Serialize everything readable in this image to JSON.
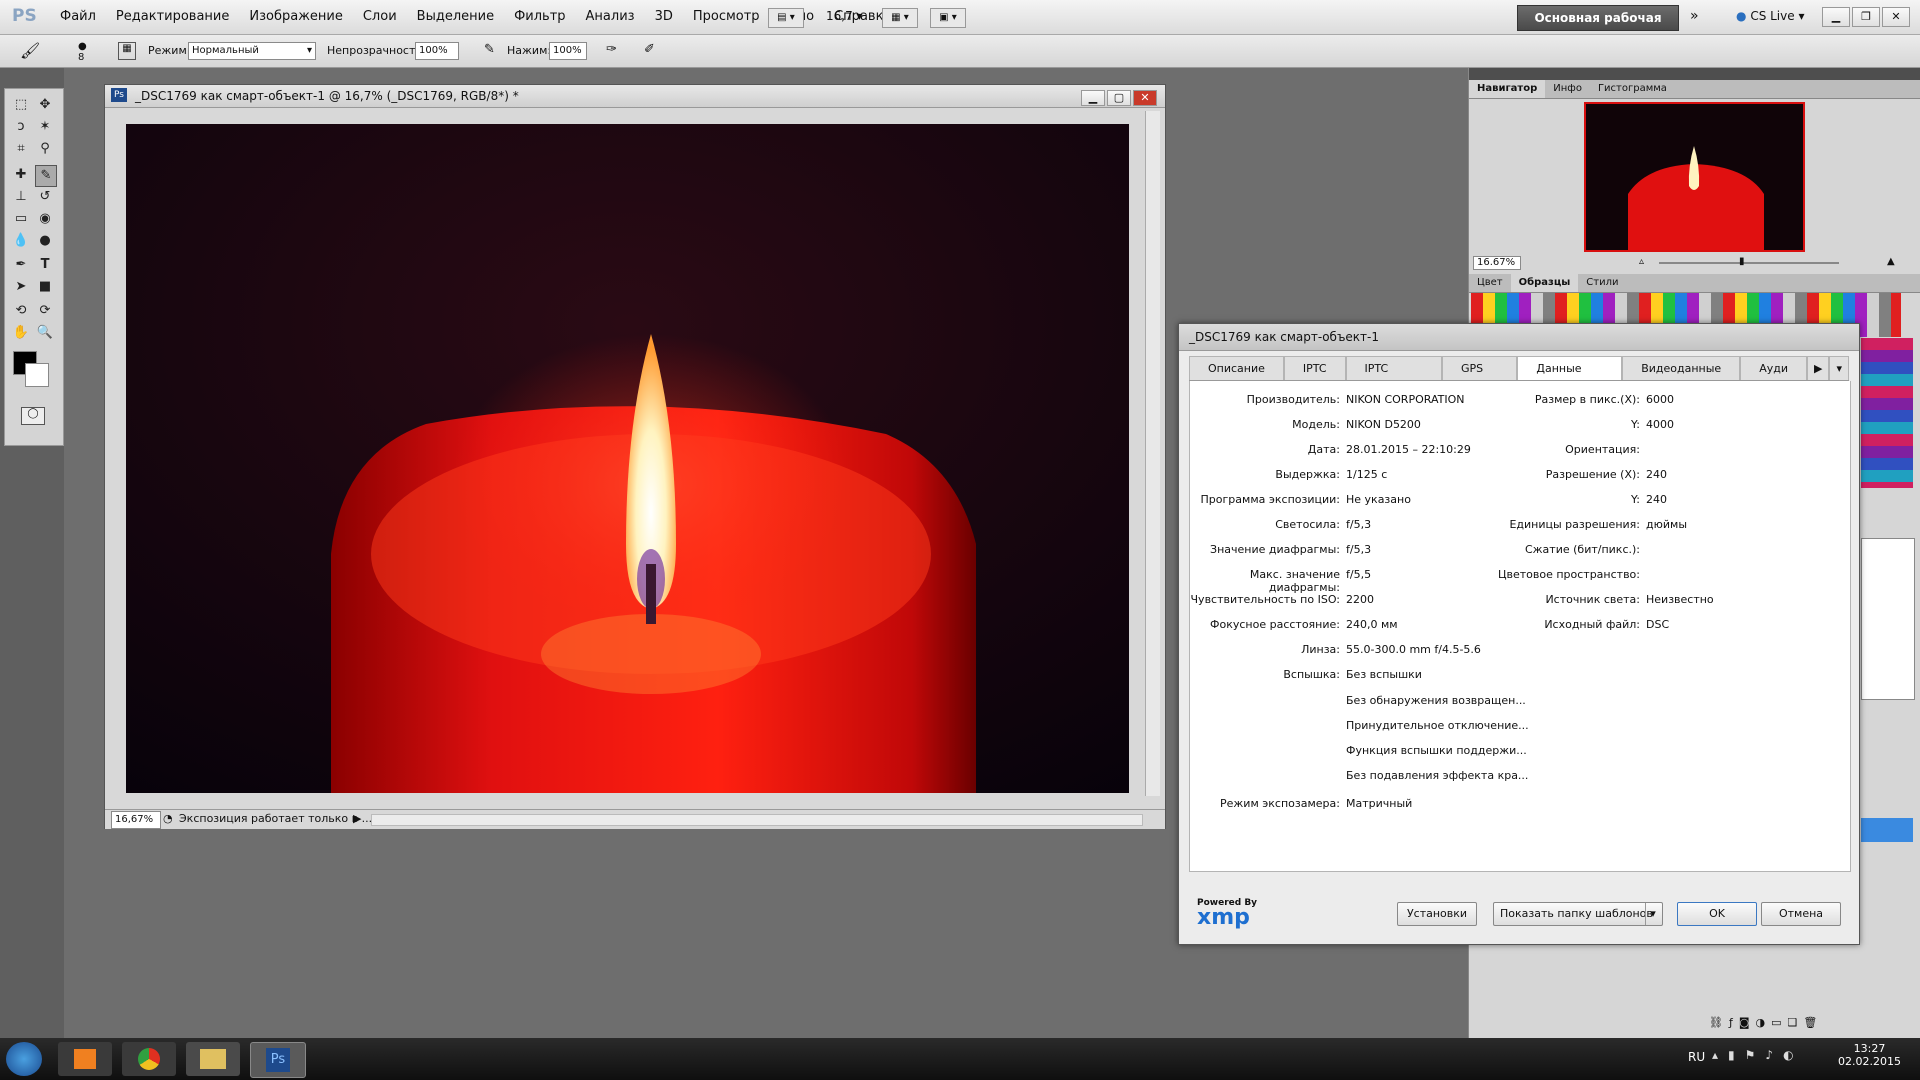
{
  "app": {
    "logo": "PS",
    "menu": [
      "Файл",
      "Редактирование",
      "Изображение",
      "Слои",
      "Выделение",
      "Фильтр",
      "Анализ",
      "3D",
      "Просмотр",
      "Окно",
      "Справка"
    ],
    "zoom_menu": "16,7",
    "workspace": "Основная рабочая среда",
    "cs_live": "CS Live"
  },
  "options": {
    "mode_label": "Режим:",
    "mode_value": "Нормальный",
    "opacity_label": "Непрозрачности:",
    "opacity_value": "100%",
    "pressure_label": "Нажим:",
    "pressure_value": "100%"
  },
  "document": {
    "title": "_DSC1769 как смарт-объект-1 @ 16,7% (_DSC1769, RGB/8*) *",
    "zoom": "16,67%",
    "status": "Экспозиция работает только в ..."
  },
  "panels": {
    "top_tabs": [
      "Навигатор",
      "Инфо",
      "Гистограмма"
    ],
    "nav_zoom": "16.67%",
    "color_tabs": [
      "Цвет",
      "Образцы",
      "Стили"
    ]
  },
  "dialog": {
    "title": "_DSC1769 как смарт-объект-1",
    "tabs": [
      "Описание",
      "IPTC",
      "IPTC Extension",
      "GPS Data",
      "Данные камеры",
      "Видеоданные",
      "Ауди"
    ],
    "active_tab": 4,
    "left_fields": [
      {
        "label": "Производитель:",
        "value": "NIKON CORPORATION"
      },
      {
        "label": "Модель:",
        "value": "NIKON D5200"
      },
      {
        "label": "Дата:",
        "value": "28.01.2015 – 22:10:29"
      },
      {
        "label": "Выдержка:",
        "value": "1/125 с"
      },
      {
        "label": "Программа экспозиции:",
        "value": "Не указано"
      },
      {
        "label": "Светосила:",
        "value": "f/5,3"
      },
      {
        "label": "Значение диафрагмы:",
        "value": "f/5,3"
      },
      {
        "label": "Макс. значение диафрагмы:",
        "value": "f/5,5"
      },
      {
        "label": "Чувствительность по ISO:",
        "value": "2200"
      },
      {
        "label": "Фокусное расстояние:",
        "value": "240,0 мм"
      },
      {
        "label": "Линза:",
        "value": "55.0-300.0 mm f/4.5-5.6"
      },
      {
        "label": "Вспышка:",
        "value": "Без вспышки"
      }
    ],
    "flash_extra": [
      "Без обнаружения возвращен...",
      "Принудительное отключение...",
      "Функция вспышки поддержи...",
      "Без подавления эффекта кра..."
    ],
    "metering": {
      "label": "Режим экспозамера:",
      "value": "Матричный"
    },
    "right_fields": [
      {
        "label": "Размер в пикс.(X):",
        "value": "6000"
      },
      {
        "label": "Y:",
        "value": "4000"
      },
      {
        "label": "Ориентация:",
        "value": ""
      },
      {
        "label": "Разрешение (X):",
        "value": "240"
      },
      {
        "label": "Y:",
        "value": "240"
      },
      {
        "label": "Единицы разрешения:",
        "value": "дюймы"
      },
      {
        "label": "Сжатие (бит/пикс.):",
        "value": ""
      },
      {
        "label": "Цветовое пространство:",
        "value": ""
      },
      {
        "label": "Источник света:",
        "value": "Неизвестно"
      },
      {
        "label": "Исходный файл:",
        "value": "DSC"
      }
    ],
    "xmp_powered": "Powered By",
    "xmp_logo": "xmp",
    "buttons": {
      "settings": "Установки",
      "show_templates": "Показать папку шаблонов",
      "ok": "OK",
      "cancel": "Отмена"
    }
  },
  "taskbar": {
    "lang": "RU",
    "time": "13:27",
    "date": "02.02.2015",
    "ps_label": "Ps"
  },
  "colors": {
    "accent": "#3b78c2",
    "candle": "#d81010",
    "flame": "#fff4c0"
  }
}
